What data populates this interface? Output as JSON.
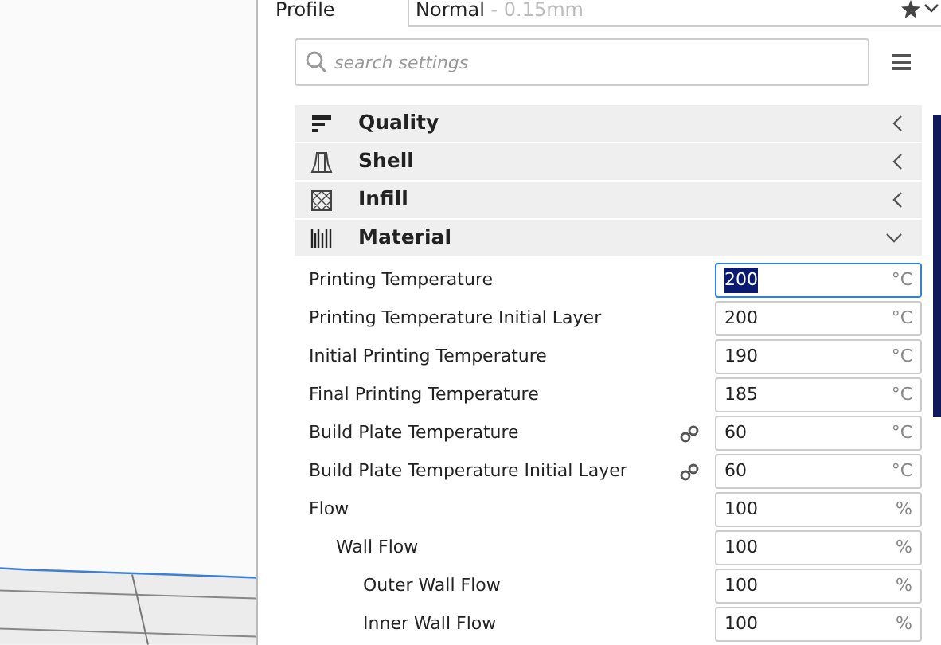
{
  "profile": {
    "label": "Profile",
    "name": "Normal",
    "detail": " - 0.15mm"
  },
  "search": {
    "placeholder": "search settings"
  },
  "categories": [
    {
      "label": "Quality",
      "kind": "quality",
      "expanded": false
    },
    {
      "label": "Shell",
      "kind": "shell",
      "expanded": false
    },
    {
      "label": "Infill",
      "kind": "infill",
      "expanded": false
    },
    {
      "label": "Material",
      "kind": "material",
      "expanded": true
    }
  ],
  "settings": [
    {
      "label": "Printing Temperature",
      "value": "200",
      "unit": "°C",
      "focused": true,
      "linked": false
    },
    {
      "label": "Printing Temperature Initial Layer",
      "value": "200",
      "unit": "°C",
      "focused": false,
      "linked": false
    },
    {
      "label": "Initial Printing Temperature",
      "value": "190",
      "unit": "°C",
      "focused": false,
      "linked": false
    },
    {
      "label": "Final Printing Temperature",
      "value": "185",
      "unit": "°C",
      "focused": false,
      "linked": false
    },
    {
      "label": "Build Plate Temperature",
      "value": "60",
      "unit": "°C",
      "focused": false,
      "linked": true
    },
    {
      "label": "Build Plate Temperature Initial Layer",
      "value": "60",
      "unit": "°C",
      "focused": false,
      "linked": true
    },
    {
      "label": "Flow",
      "value": "100",
      "unit": "%",
      "focused": false,
      "linked": false,
      "children": [
        {
          "label": "Wall Flow",
          "value": "100",
          "unit": "%",
          "focused": false,
          "linked": false,
          "children": [
            {
              "label": "Outer Wall Flow",
              "value": "100",
              "unit": "%",
              "focused": false,
              "linked": false
            },
            {
              "label": "Inner Wall Flow",
              "value": "100",
              "unit": "%",
              "focused": false,
              "linked": false
            }
          ]
        }
      ]
    }
  ]
}
